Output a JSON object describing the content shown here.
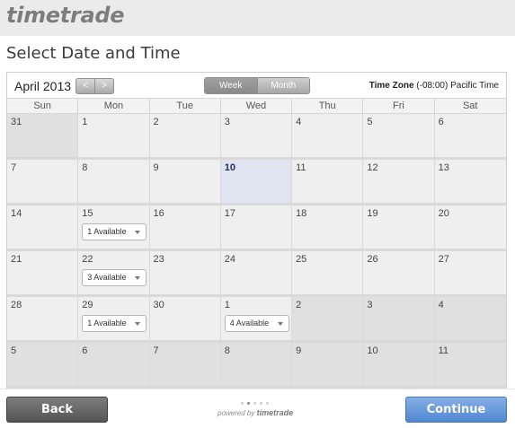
{
  "brand": {
    "logo_text": "timetrade"
  },
  "page": {
    "title": "Select Date and Time"
  },
  "calendar": {
    "month_label": "April 2013",
    "prev_label": "<",
    "next_label": ">",
    "views": [
      {
        "label": "Week",
        "active": true
      },
      {
        "label": "Month",
        "active": false
      }
    ],
    "timezone_label": "Time Zone",
    "timezone_value": " (-08:00) Pacific Time",
    "weekdays": [
      "Sun",
      "Mon",
      "Tue",
      "Wed",
      "Thu",
      "Fri",
      "Sat"
    ],
    "weeks": [
      [
        {
          "day": "31",
          "other": true
        },
        {
          "day": "1"
        },
        {
          "day": "2"
        },
        {
          "day": "3"
        },
        {
          "day": "4"
        },
        {
          "day": "5"
        },
        {
          "day": "6"
        }
      ],
      [
        {
          "day": "7"
        },
        {
          "day": "8"
        },
        {
          "day": "9"
        },
        {
          "day": "10",
          "today": true
        },
        {
          "day": "11"
        },
        {
          "day": "12"
        },
        {
          "day": "13"
        }
      ],
      [
        {
          "day": "14"
        },
        {
          "day": "15",
          "available": "1 Available"
        },
        {
          "day": "16"
        },
        {
          "day": "17"
        },
        {
          "day": "18"
        },
        {
          "day": "19"
        },
        {
          "day": "20"
        }
      ],
      [
        {
          "day": "21"
        },
        {
          "day": "22",
          "available": "3 Available"
        },
        {
          "day": "23"
        },
        {
          "day": "24"
        },
        {
          "day": "25"
        },
        {
          "day": "26"
        },
        {
          "day": "27"
        }
      ],
      [
        {
          "day": "28"
        },
        {
          "day": "29",
          "available": "1 Available"
        },
        {
          "day": "30"
        },
        {
          "day": "1",
          "available": "4 Available"
        },
        {
          "day": "2",
          "other": true
        },
        {
          "day": "3",
          "other": true
        },
        {
          "day": "4",
          "other": true
        }
      ],
      [
        {
          "day": "5",
          "other": true
        },
        {
          "day": "6",
          "other": true
        },
        {
          "day": "7",
          "other": true
        },
        {
          "day": "8",
          "other": true
        },
        {
          "day": "9",
          "other": true
        },
        {
          "day": "10",
          "other": true
        },
        {
          "day": "11",
          "other": true
        }
      ]
    ]
  },
  "footer": {
    "back_label": "Back",
    "continue_label": "Continue",
    "progress": {
      "steps": 5,
      "current": 2
    },
    "powered_prefix": "powered by ",
    "powered_brand": "timetrade"
  },
  "colors": {
    "continue": "#5b8fd6",
    "back": "#666666",
    "today": "#dfe4f0"
  },
  "icons": {
    "dropdown": "chevron-down-icon"
  }
}
